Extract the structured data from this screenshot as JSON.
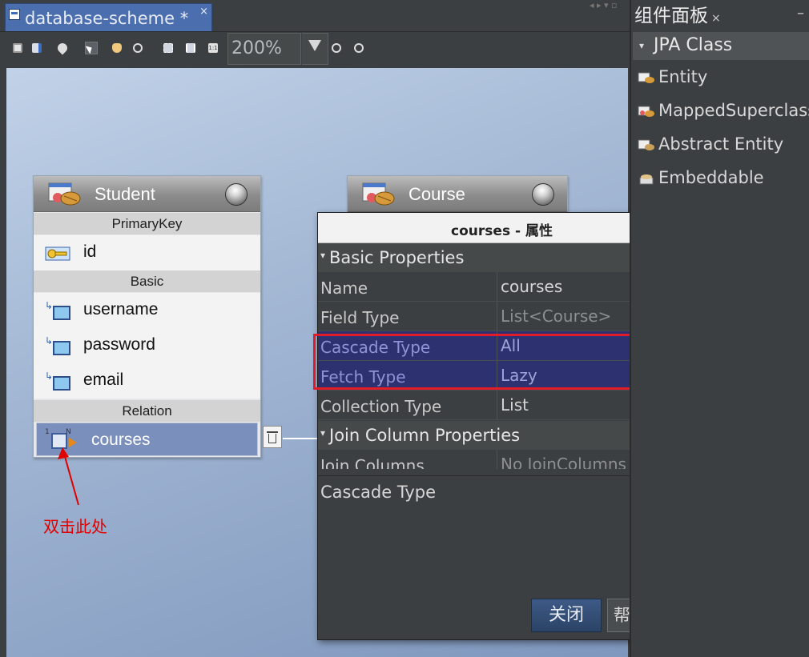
{
  "editor": {
    "tab_label": "database-scheme *",
    "tab_close": "×",
    "zoom_value": "200%"
  },
  "diagram": {
    "student": {
      "title": "Student",
      "sections": {
        "primary_key": "PrimaryKey",
        "basic": "Basic",
        "relation": "Relation"
      },
      "primary_key_field": "id",
      "basic_fields": [
        "username",
        "password",
        "email"
      ],
      "relation_fields": [
        "courses"
      ]
    },
    "course": {
      "title": "Course"
    }
  },
  "annotation": {
    "callout_text": "双击此处",
    "color": "#e00000"
  },
  "dialog": {
    "title": "courses - 属性",
    "close_glyph": "×",
    "categories": {
      "basic": "Basic Properties",
      "join": "Join Column Properties"
    },
    "properties": [
      {
        "name": "Name",
        "value": "courses"
      },
      {
        "name": "Field Type",
        "value": "List<Course>"
      },
      {
        "name": "Cascade Type",
        "value": "All"
      },
      {
        "name": "Fetch Type",
        "value": "Lazy"
      },
      {
        "name": "Collection Type",
        "value": "List"
      },
      {
        "name": "Join Columns",
        "value": "No JoinColumns"
      }
    ],
    "description_title": "Cascade Type",
    "close_button": "关闭",
    "help_button": "帮助(H)",
    "highlight_color": "#e21b2b"
  },
  "palette": {
    "tab_label": "组件面板",
    "category": "JPA Class",
    "items": [
      "Entity",
      "MappedSuperclass",
      "Abstract Entity",
      "Embeddable"
    ]
  },
  "colors": {
    "accent": "#4b6eaf",
    "selection_row": "#7b8fbd",
    "highlight_row": "#2e3170"
  }
}
